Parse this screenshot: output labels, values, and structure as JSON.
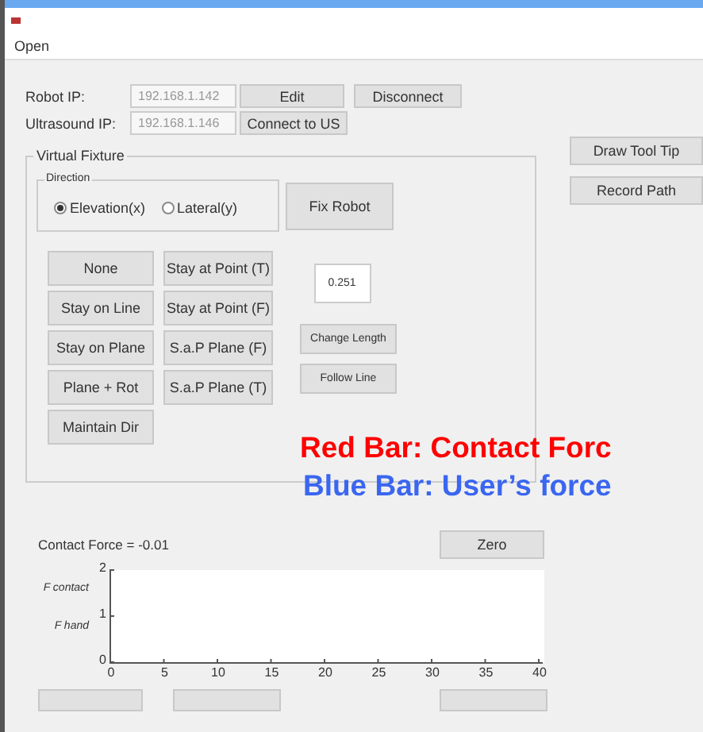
{
  "menu": [
    "Open"
  ],
  "connection": [
    {
      "label": "Robot IP:",
      "value": "192.168.1.142",
      "buttons": [
        "Edit",
        "Disconnect"
      ]
    },
    {
      "label": "Ultrasound IP:",
      "value": "192.168.1.146",
      "buttons": [
        "Connect to US"
      ]
    }
  ],
  "side_buttons": [
    "Draw Tool Tip",
    "Record Path"
  ],
  "virtual_fixture": {
    "title": "Virtual Fixture",
    "direction": {
      "title": "Direction",
      "options": [
        {
          "label": "Elevation(x)",
          "selected": true
        },
        {
          "label": "Lateral(y)",
          "selected": false
        }
      ]
    },
    "fix_button": "Fix Robot",
    "column_1": [
      "None",
      "Stay on Line",
      "Stay on Plane",
      "Plane + Rot",
      "Maintain Dir"
    ],
    "column_2": [
      "Stay at Point (T)",
      "Stay at Point (F)",
      "S.a.P Plane (F)",
      "S.a.P Plane (T)"
    ],
    "length_value": "0.251",
    "column_3": [
      "Change Length",
      "Follow Line"
    ]
  },
  "annotations": [
    {
      "text": "Red Bar: Contact Forc",
      "color": "#ff0000"
    },
    {
      "text": "Blue Bar: User’s force",
      "color": "#3a66f0"
    }
  ],
  "force": {
    "label": "Contact Force = -0.01",
    "zero_button": "Zero",
    "plot": {
      "bar_labels": [
        "F contact",
        "F hand"
      ],
      "yticks": [
        "2",
        "1",
        "0"
      ],
      "xticks": [
        "0",
        "5",
        "10",
        "15",
        "20",
        "25",
        "30",
        "35",
        "40"
      ]
    }
  }
}
